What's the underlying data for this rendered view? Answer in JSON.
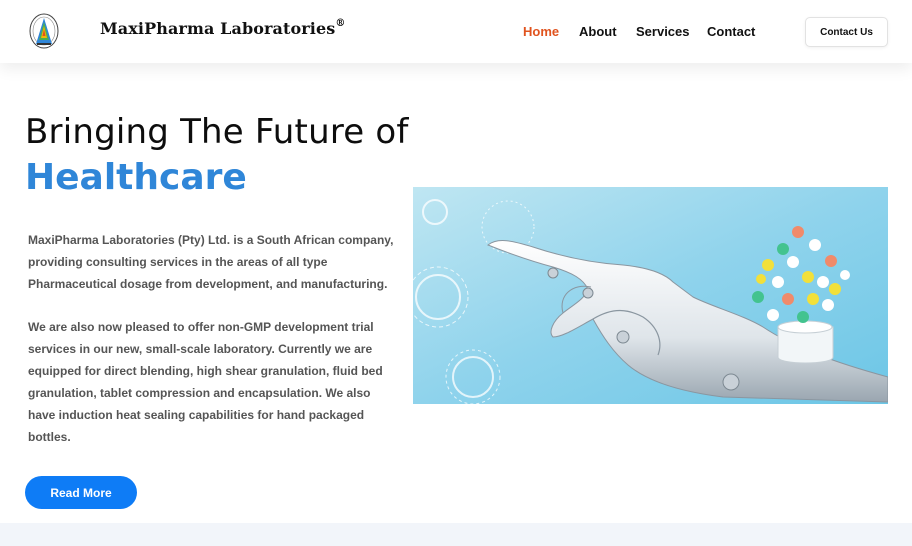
{
  "header": {
    "brand": "MaxiPharma Laboratories",
    "brand_mark": "®",
    "nav": [
      "Home",
      "About",
      "Services",
      "Contact"
    ],
    "active_nav": "Home",
    "cta": "Contact Us"
  },
  "hero": {
    "title_line1": "Bringing The Future of",
    "title_line2": "Healthcare",
    "paragraph1": "MaxiPharma Laboratories (Pty) Ltd. is a South African company, providing consulting services in the areas of all type Pharmaceutical dosage from development, and manufacturing.",
    "paragraph2": "We are also now pleased to offer non-GMP development trial services in our new, small-scale laboratory. Currently we are equipped for direct blending, high shear granulation, fluid bed granulation, tablet compression and encapsulation. We also have induction heat sealing capabilities for hand packaged bottles.",
    "button": "Read More"
  },
  "colors": {
    "accent_blue": "#2f86d8",
    "button_blue": "#0e7cf6",
    "nav_active": "#e0531e"
  },
  "icons": [
    "company-logo-icon"
  ],
  "image": "robot-hand-with-pills-image"
}
